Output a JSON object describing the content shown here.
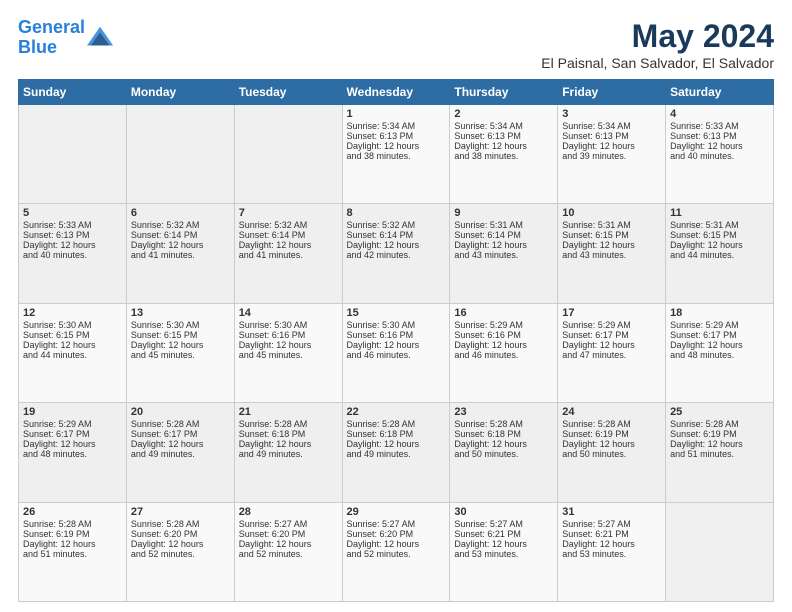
{
  "logo": {
    "line1": "General",
    "line2": "Blue"
  },
  "title": "May 2024",
  "subtitle": "El Paisnal, San Salvador, El Salvador",
  "days_of_week": [
    "Sunday",
    "Monday",
    "Tuesday",
    "Wednesday",
    "Thursday",
    "Friday",
    "Saturday"
  ],
  "weeks": [
    [
      {
        "day": "",
        "content": ""
      },
      {
        "day": "",
        "content": ""
      },
      {
        "day": "",
        "content": ""
      },
      {
        "day": "1",
        "content": "Sunrise: 5:34 AM\nSunset: 6:13 PM\nDaylight: 12 hours\nand 38 minutes."
      },
      {
        "day": "2",
        "content": "Sunrise: 5:34 AM\nSunset: 6:13 PM\nDaylight: 12 hours\nand 38 minutes."
      },
      {
        "day": "3",
        "content": "Sunrise: 5:34 AM\nSunset: 6:13 PM\nDaylight: 12 hours\nand 39 minutes."
      },
      {
        "day": "4",
        "content": "Sunrise: 5:33 AM\nSunset: 6:13 PM\nDaylight: 12 hours\nand 40 minutes."
      }
    ],
    [
      {
        "day": "5",
        "content": "Sunrise: 5:33 AM\nSunset: 6:13 PM\nDaylight: 12 hours\nand 40 minutes."
      },
      {
        "day": "6",
        "content": "Sunrise: 5:32 AM\nSunset: 6:14 PM\nDaylight: 12 hours\nand 41 minutes."
      },
      {
        "day": "7",
        "content": "Sunrise: 5:32 AM\nSunset: 6:14 PM\nDaylight: 12 hours\nand 41 minutes."
      },
      {
        "day": "8",
        "content": "Sunrise: 5:32 AM\nSunset: 6:14 PM\nDaylight: 12 hours\nand 42 minutes."
      },
      {
        "day": "9",
        "content": "Sunrise: 5:31 AM\nSunset: 6:14 PM\nDaylight: 12 hours\nand 43 minutes."
      },
      {
        "day": "10",
        "content": "Sunrise: 5:31 AM\nSunset: 6:15 PM\nDaylight: 12 hours\nand 43 minutes."
      },
      {
        "day": "11",
        "content": "Sunrise: 5:31 AM\nSunset: 6:15 PM\nDaylight: 12 hours\nand 44 minutes."
      }
    ],
    [
      {
        "day": "12",
        "content": "Sunrise: 5:30 AM\nSunset: 6:15 PM\nDaylight: 12 hours\nand 44 minutes."
      },
      {
        "day": "13",
        "content": "Sunrise: 5:30 AM\nSunset: 6:15 PM\nDaylight: 12 hours\nand 45 minutes."
      },
      {
        "day": "14",
        "content": "Sunrise: 5:30 AM\nSunset: 6:16 PM\nDaylight: 12 hours\nand 45 minutes."
      },
      {
        "day": "15",
        "content": "Sunrise: 5:30 AM\nSunset: 6:16 PM\nDaylight: 12 hours\nand 46 minutes."
      },
      {
        "day": "16",
        "content": "Sunrise: 5:29 AM\nSunset: 6:16 PM\nDaylight: 12 hours\nand 46 minutes."
      },
      {
        "day": "17",
        "content": "Sunrise: 5:29 AM\nSunset: 6:17 PM\nDaylight: 12 hours\nand 47 minutes."
      },
      {
        "day": "18",
        "content": "Sunrise: 5:29 AM\nSunset: 6:17 PM\nDaylight: 12 hours\nand 48 minutes."
      }
    ],
    [
      {
        "day": "19",
        "content": "Sunrise: 5:29 AM\nSunset: 6:17 PM\nDaylight: 12 hours\nand 48 minutes."
      },
      {
        "day": "20",
        "content": "Sunrise: 5:28 AM\nSunset: 6:17 PM\nDaylight: 12 hours\nand 49 minutes."
      },
      {
        "day": "21",
        "content": "Sunrise: 5:28 AM\nSunset: 6:18 PM\nDaylight: 12 hours\nand 49 minutes."
      },
      {
        "day": "22",
        "content": "Sunrise: 5:28 AM\nSunset: 6:18 PM\nDaylight: 12 hours\nand 49 minutes."
      },
      {
        "day": "23",
        "content": "Sunrise: 5:28 AM\nSunset: 6:18 PM\nDaylight: 12 hours\nand 50 minutes."
      },
      {
        "day": "24",
        "content": "Sunrise: 5:28 AM\nSunset: 6:19 PM\nDaylight: 12 hours\nand 50 minutes."
      },
      {
        "day": "25",
        "content": "Sunrise: 5:28 AM\nSunset: 6:19 PM\nDaylight: 12 hours\nand 51 minutes."
      }
    ],
    [
      {
        "day": "26",
        "content": "Sunrise: 5:28 AM\nSunset: 6:19 PM\nDaylight: 12 hours\nand 51 minutes."
      },
      {
        "day": "27",
        "content": "Sunrise: 5:28 AM\nSunset: 6:20 PM\nDaylight: 12 hours\nand 52 minutes."
      },
      {
        "day": "28",
        "content": "Sunrise: 5:27 AM\nSunset: 6:20 PM\nDaylight: 12 hours\nand 52 minutes."
      },
      {
        "day": "29",
        "content": "Sunrise: 5:27 AM\nSunset: 6:20 PM\nDaylight: 12 hours\nand 52 minutes."
      },
      {
        "day": "30",
        "content": "Sunrise: 5:27 AM\nSunset: 6:21 PM\nDaylight: 12 hours\nand 53 minutes."
      },
      {
        "day": "31",
        "content": "Sunrise: 5:27 AM\nSunset: 6:21 PM\nDaylight: 12 hours\nand 53 minutes."
      },
      {
        "day": "",
        "content": ""
      }
    ]
  ]
}
